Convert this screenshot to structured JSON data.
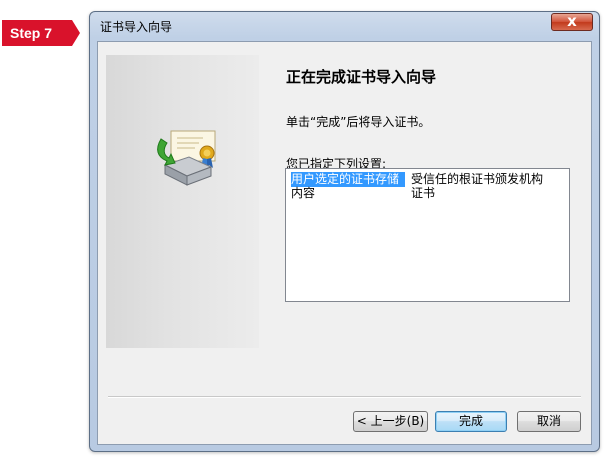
{
  "step_badge": {
    "label": "Step 7",
    "color": "#d9122b"
  },
  "window": {
    "title": "证书导入向导",
    "close_glyph": "x"
  },
  "wizard": {
    "heading": "正在完成证书导入向导",
    "instruction": "单击“完成”后将导入证书。",
    "settings_label": "您已指定下列设置:",
    "settings": [
      {
        "key": "用户选定的证书存储",
        "value": "受信任的根证书颁发机构",
        "selected": true
      },
      {
        "key": "内容",
        "value": "证书",
        "selected": false
      }
    ]
  },
  "buttons": {
    "back": "< 上一步(B)",
    "finish": "完成",
    "cancel": "取消"
  },
  "icons": {
    "wizard_icon": "certificate-import-icon",
    "close_icon": "close-icon"
  }
}
